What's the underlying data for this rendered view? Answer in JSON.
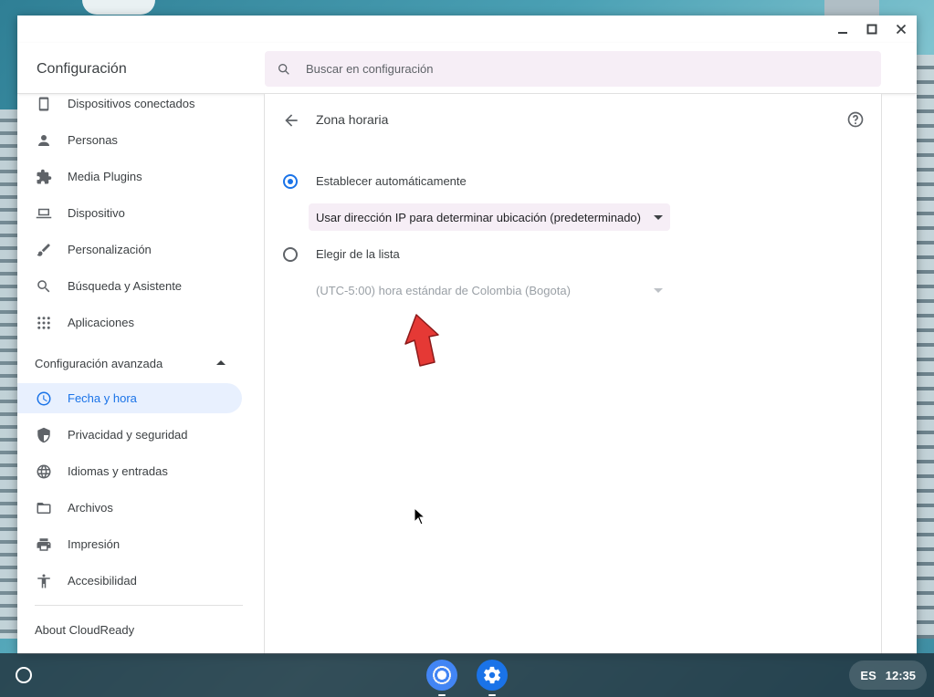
{
  "window": {
    "app_title": "Configuración",
    "search_placeholder": "Buscar en configuración"
  },
  "sidebar": {
    "items": [
      {
        "label": "Dispositivos conectados",
        "icon": "phone-icon"
      },
      {
        "label": "Personas",
        "icon": "person-icon"
      },
      {
        "label": "Media Plugins",
        "icon": "puzzle-icon"
      },
      {
        "label": "Dispositivo",
        "icon": "laptop-icon"
      },
      {
        "label": "Personalización",
        "icon": "brush-icon"
      },
      {
        "label": "Búsqueda y Asistente",
        "icon": "search-icon"
      },
      {
        "label": "Aplicaciones",
        "icon": "apps-grid-icon"
      }
    ],
    "advanced_label": "Configuración avanzada",
    "advanced_items": [
      {
        "label": "Fecha y hora",
        "icon": "clock-icon",
        "active": true
      },
      {
        "label": "Privacidad y seguridad",
        "icon": "shield-icon"
      },
      {
        "label": "Idiomas y entradas",
        "icon": "globe-icon"
      },
      {
        "label": "Archivos",
        "icon": "folder-icon"
      },
      {
        "label": "Impresión",
        "icon": "printer-icon"
      },
      {
        "label": "Accesibilidad",
        "icon": "accessibility-icon"
      }
    ],
    "about_label": "About CloudReady"
  },
  "main": {
    "title": "Zona horaria",
    "auto": {
      "label": "Establecer automáticamente",
      "checked": true,
      "select_value": "Usar dirección IP para determinar ubicación (predeterminado)"
    },
    "list": {
      "label": "Elegir de la lista",
      "checked": false,
      "select_value": "(UTC-5:00) hora estándar de Colombia (Bogota)"
    }
  },
  "shelf": {
    "language": "ES",
    "time": "12:35"
  },
  "colors": {
    "accent": "#1a73e8",
    "annotation_arrow": "#e53935"
  }
}
